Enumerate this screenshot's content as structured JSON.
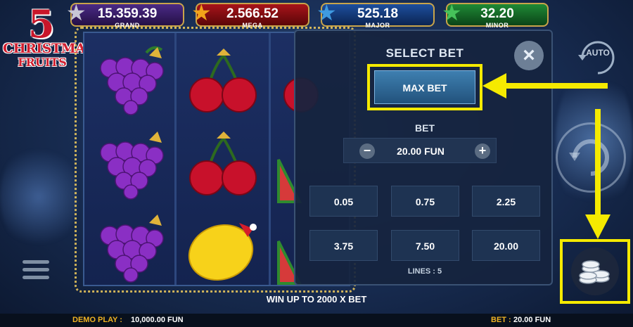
{
  "logo": {
    "number": "5",
    "line1": "CHRISTMAS",
    "line2": "FRUITS"
  },
  "jackpots": [
    {
      "value": "15.359.39",
      "label": "GRAND",
      "star_color": "#c7c7d6"
    },
    {
      "value": "2.566.52",
      "label": "MEGA",
      "star_color": "#f2a31a"
    },
    {
      "value": "525.18",
      "label": "MAJOR",
      "star_color": "#3f9ae0"
    },
    {
      "value": "32.20",
      "label": "MINOR",
      "star_color": "#46c25a"
    }
  ],
  "reels": {
    "col1": [
      "grapes",
      "grapes",
      "grapes"
    ],
    "col2": [
      "cherries",
      "cherries",
      "lemon"
    ],
    "col3": [
      "cherries",
      "watermelon",
      "watermelon"
    ]
  },
  "panel": {
    "title": "SELECT BET",
    "close_icon": "close-icon",
    "max_bet_label": "MAX BET",
    "bet_label": "BET",
    "bet_value": "20.00 FUN",
    "minus": "−",
    "plus": "+",
    "options": [
      "0.05",
      "0.75",
      "2.25",
      "3.75",
      "7.50",
      "20.00"
    ],
    "lines": "LINES : 5"
  },
  "controls": {
    "auto_label": "AUTO"
  },
  "win_text": "WIN UP TO 2000 X BET",
  "bottom": {
    "demo_label": "DEMO PLAY :",
    "demo_value": "10,000.00 FUN",
    "bet_label": "BET :",
    "bet_value": "20.00 FUN"
  },
  "colors": {
    "highlight": "#f5ea00",
    "accent": "#f0b323"
  }
}
